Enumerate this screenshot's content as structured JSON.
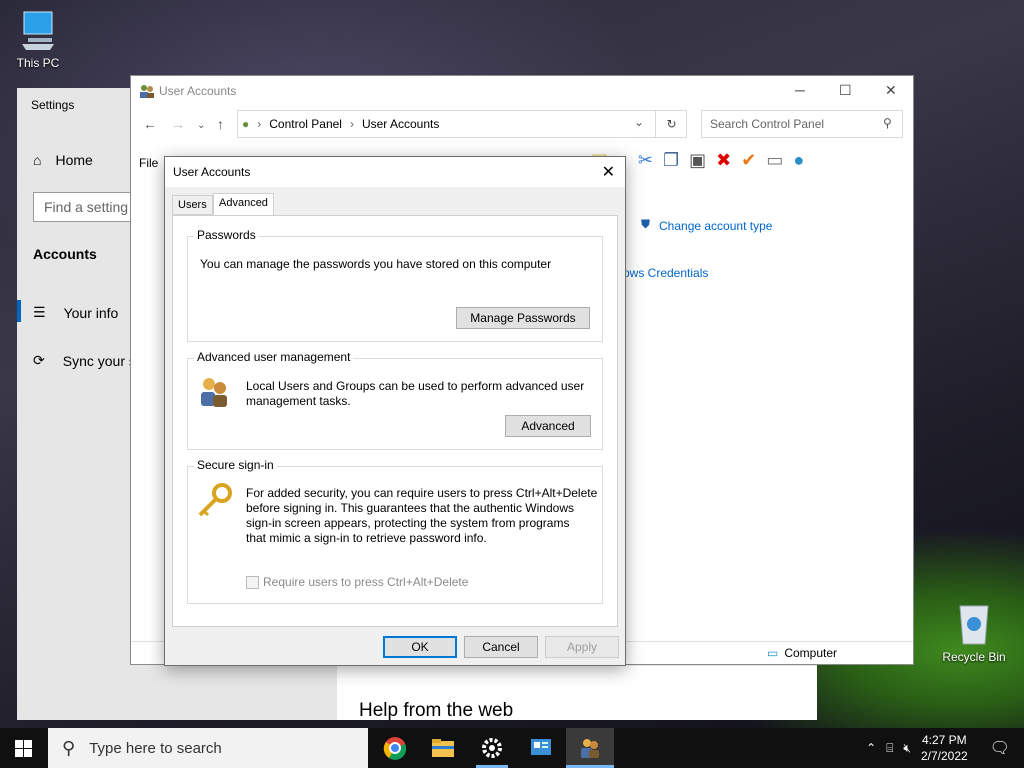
{
  "desktop": {
    "icons": [
      {
        "label": "This PC",
        "icon": "computer-icon"
      },
      {
        "label": "Recycle Bin",
        "icon": "recycle-bin-icon"
      }
    ]
  },
  "settings": {
    "title": "Settings",
    "home": "Home",
    "search_placeholder": "Find a setting",
    "section": "Accounts",
    "nav": [
      {
        "label": "Your info",
        "icon": "person-card-icon",
        "selected": true
      },
      {
        "label": "Sync your s",
        "icon": "sync-icon",
        "selected": false
      }
    ],
    "help_heading": "Help from the web"
  },
  "explorer": {
    "title": "User Accounts",
    "breadcrumb": [
      "Control Panel",
      "User Accounts"
    ],
    "search_placeholder": "Search Control Panel",
    "menu_file": "File",
    "links": {
      "change_account_type": "Change account type",
      "windows_credentials": "ows Credentials"
    },
    "status_location": "Computer"
  },
  "dialog": {
    "title": "User Accounts",
    "tabs": [
      "Users",
      "Advanced"
    ],
    "active_tab": "Advanced",
    "passwords": {
      "legend": "Passwords",
      "text": "You can manage the passwords you have stored on this computer",
      "button": "Manage Passwords"
    },
    "advanced_mgmt": {
      "legend": "Advanced user management",
      "text_line1": "Local Users and Groups can be used to perform advanced user",
      "text_line2": "management tasks.",
      "button": "Advanced"
    },
    "secure_signin": {
      "legend": "Secure sign-in",
      "text_line1": "For added security, you can require users to press Ctrl+Alt+Delete",
      "text_line2": "before signing in. This guarantees that the authentic Windows",
      "text_line3": "sign-in screen appears, protecting the system from programs",
      "text_line4": "that mimic a sign-in to retrieve password info.",
      "checkbox_label": "Require users to press Ctrl+Alt+Delete",
      "checkbox_checked": false
    },
    "buttons": {
      "ok": "OK",
      "cancel": "Cancel",
      "apply": "Apply"
    }
  },
  "taskbar": {
    "search_placeholder": "Type here to search",
    "time": "4:27 PM",
    "date": "2/7/2022"
  }
}
